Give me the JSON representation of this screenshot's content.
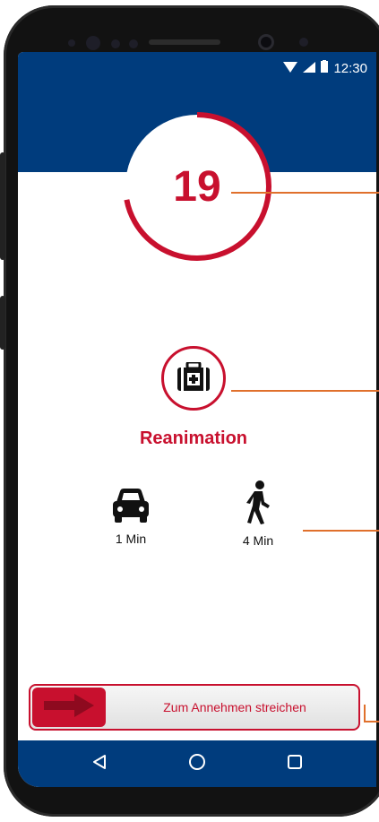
{
  "status_bar": {
    "time": "12:30"
  },
  "countdown": {
    "value": "19",
    "progress": 0.72
  },
  "emergency": {
    "type": "Reanimation"
  },
  "transport": {
    "car": {
      "label": "1 Min"
    },
    "walk": {
      "label": "4 Min"
    }
  },
  "accept_slider": {
    "label": "Zum Annehmen streichen"
  },
  "colors": {
    "brand_blue": "#003c7d",
    "accent_red": "#c8102e",
    "callout": "#e0702c"
  }
}
